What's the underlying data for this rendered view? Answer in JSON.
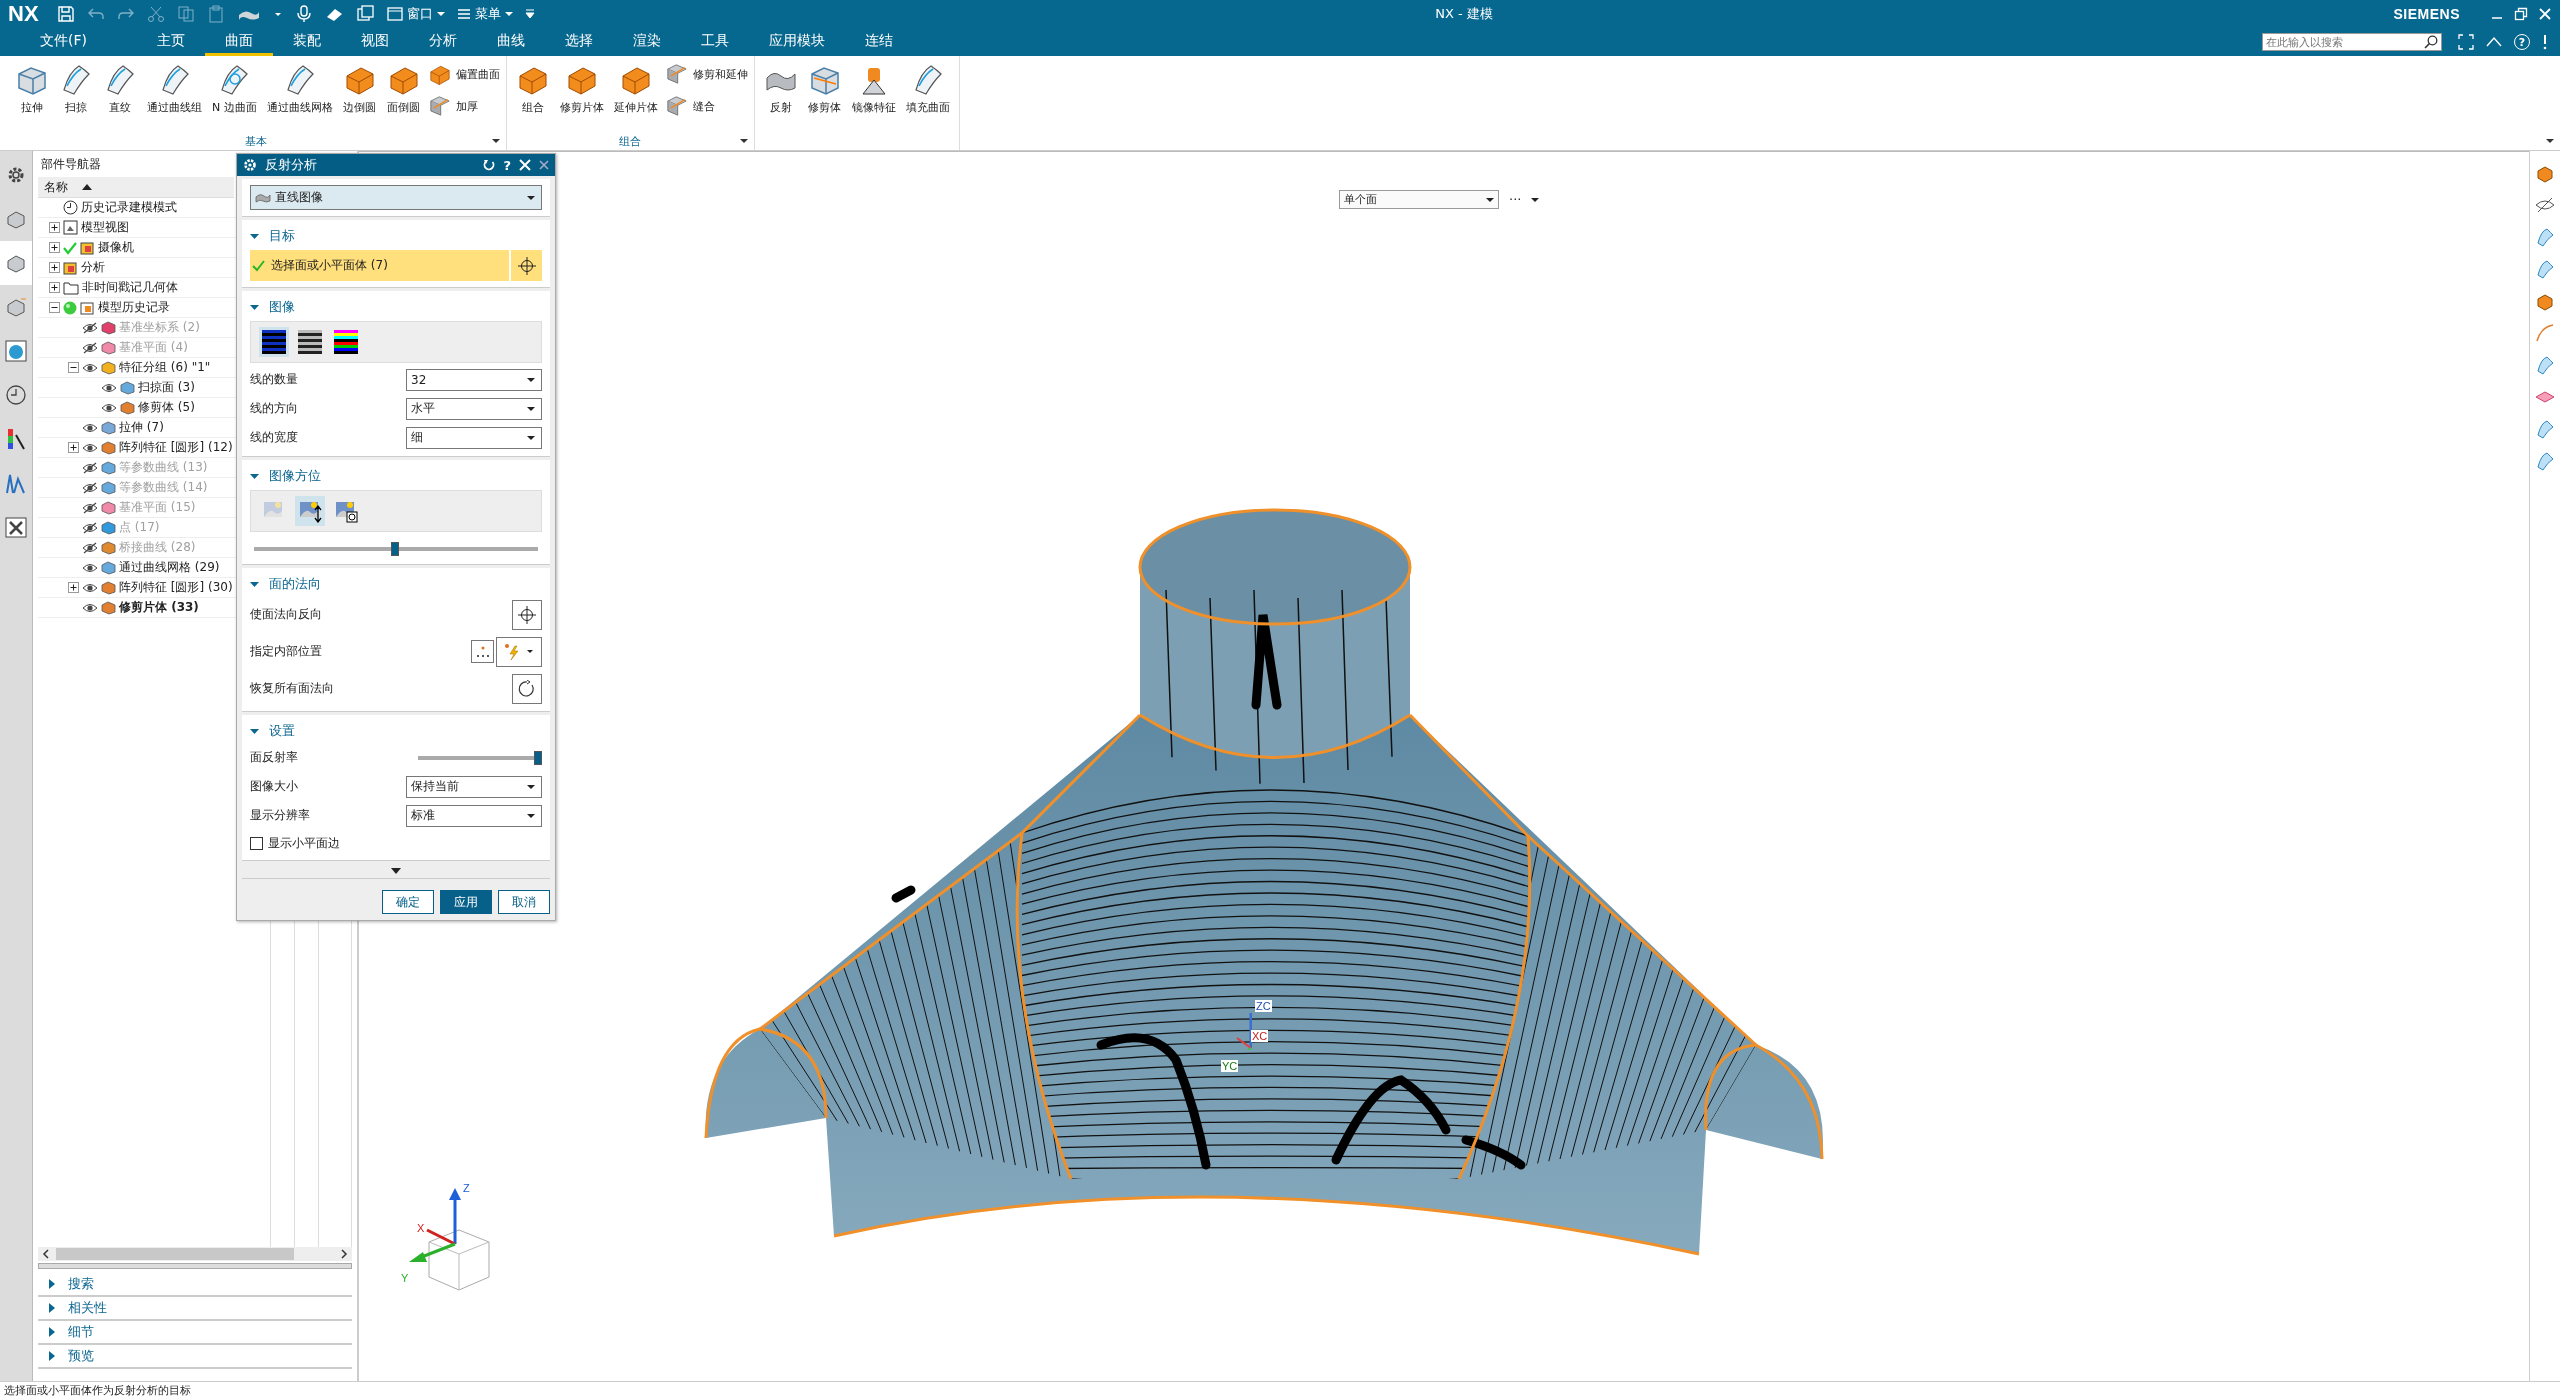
{
  "window": {
    "logo": "NX",
    "title": "NX - 建模",
    "brand": "SIEMENS"
  },
  "quick_access": {
    "window_menu": "窗口",
    "main_menu": "菜单"
  },
  "menu_tabs": [
    {
      "label": "文件(F)",
      "selected": false
    },
    {
      "label": "主页",
      "selected": false
    },
    {
      "label": "曲面",
      "selected": true
    },
    {
      "label": "装配",
      "selected": false
    },
    {
      "label": "视图",
      "selected": false
    },
    {
      "label": "分析",
      "selected": false
    },
    {
      "label": "曲线",
      "selected": false
    },
    {
      "label": "选择",
      "selected": false
    },
    {
      "label": "渲染",
      "selected": false
    },
    {
      "label": "工具",
      "selected": false
    },
    {
      "label": "应用模块",
      "selected": false
    },
    {
      "label": "连结",
      "selected": false
    }
  ],
  "search": {
    "placeholder": "在此输入以搜索"
  },
  "help_label": "?",
  "ribbon": {
    "groups": [
      {
        "label": "基本",
        "items": [
          {
            "label": "拉伸",
            "kind": "large"
          },
          {
            "label": "扫掠",
            "kind": "large"
          },
          {
            "label": "直纹",
            "kind": "large"
          },
          {
            "label": "通过曲线组",
            "kind": "large"
          },
          {
            "label": "N 边曲面",
            "kind": "large"
          },
          {
            "label": "通过曲线网格",
            "kind": "large"
          },
          {
            "label": "边倒圆",
            "kind": "large"
          },
          {
            "label": "面倒圆",
            "kind": "large"
          },
          {
            "label": "偏置曲面",
            "kind": "small"
          },
          {
            "label": "加厚",
            "kind": "small"
          }
        ]
      },
      {
        "label": "组合",
        "items": [
          {
            "label": "组合",
            "kind": "large"
          },
          {
            "label": "修剪片体",
            "kind": "large"
          },
          {
            "label": "延伸片体",
            "kind": "large"
          },
          {
            "label": "修剪和延伸",
            "kind": "small"
          },
          {
            "label": "缝合",
            "kind": "small"
          }
        ]
      },
      {
        "items": [
          {
            "label": "反射",
            "kind": "large"
          },
          {
            "label": "修剪体",
            "kind": "large"
          },
          {
            "label": "镜像特征",
            "kind": "large"
          },
          {
            "label": "填充曲面",
            "kind": "large"
          }
        ]
      }
    ]
  },
  "navigator": {
    "title": "部件导航器",
    "column": "名称",
    "tree": [
      {
        "label": "历史记录建模模式",
        "kind": "mode"
      },
      {
        "label": "模型视图",
        "kind": "views",
        "expanded": false
      },
      {
        "label": "摄像机",
        "kind": "cameras",
        "expanded": false
      },
      {
        "label": "分析",
        "kind": "analysis",
        "expanded": false
      },
      {
        "label": "非时间戳记几何体",
        "kind": "folder",
        "expanded": false
      },
      {
        "label": "模型历史记录",
        "kind": "history",
        "expanded": true,
        "children": [
          {
            "label": "基准坐标系 (2)",
            "visible": false,
            "current": false
          },
          {
            "label": "基准平面 (4)",
            "visible": false,
            "current": false
          },
          {
            "label": "特征分组 (6) \"1\"",
            "visible": true,
            "current": false,
            "expanded": true,
            "children": [
              {
                "label": "扫掠面 (3)",
                "visible": true,
                "current": false
              },
              {
                "label": "修剪体 (5)",
                "visible": true,
                "current": false
              }
            ]
          },
          {
            "label": "拉伸 (7)",
            "visible": true,
            "current": false
          },
          {
            "label": "阵列特征 [圆形] (12)",
            "visible": true,
            "current": false,
            "expanded": false
          },
          {
            "label": "等参数曲线 (13)",
            "visible": false,
            "current": false
          },
          {
            "label": "等参数曲线 (14)",
            "visible": false,
            "current": false
          },
          {
            "label": "基准平面 (15)",
            "visible": false,
            "current": false
          },
          {
            "label": "点 (17)",
            "visible": false,
            "current": false
          },
          {
            "label": "桥接曲线 (28)",
            "visible": false,
            "current": false
          },
          {
            "label": "通过曲线网格 (29)",
            "visible": true,
            "current": false
          },
          {
            "label": "阵列特征 [圆形] (30)",
            "visible": true,
            "current": false,
            "expanded": false
          },
          {
            "label": "修剪片体 (33)",
            "visible": true,
            "current": true
          }
        ]
      }
    ],
    "panels": [
      {
        "label": "搜索",
        "expanded": false
      },
      {
        "label": "相关性",
        "expanded": false
      },
      {
        "label": "细节",
        "expanded": false
      },
      {
        "label": "预览",
        "expanded": false
      }
    ]
  },
  "dialog": {
    "title": "反射分析",
    "help_label": "?",
    "type": {
      "value": "直线图像"
    },
    "sections": [
      {
        "kind": "target",
        "title": "目标",
        "expanded": true,
        "selection": {
          "label": "选择面或小平面体 (7)",
          "done": true
        }
      },
      {
        "kind": "image",
        "title": "图像",
        "expanded": true,
        "image_types": [
          {
            "selected": true
          },
          {
            "selected": false
          },
          {
            "selected": false
          }
        ],
        "fields": [
          {
            "label": "线的数量",
            "value": "32"
          },
          {
            "label": "线的方向",
            "value": "水平"
          },
          {
            "label": "线的宽度",
            "value": "细"
          }
        ]
      },
      {
        "kind": "orientation",
        "title": "图像方位",
        "expanded": true,
        "modes": [
          {
            "selected": false,
            "disabled": true
          },
          {
            "selected": true,
            "disabled": false
          },
          {
            "selected": false,
            "disabled": false
          }
        ],
        "slider": {
          "level": 0.5
        }
      },
      {
        "kind": "normals",
        "title": "面的法向",
        "expanded": true,
        "rows": [
          {
            "label": "使面法向反向",
            "kind": "pick"
          },
          {
            "label": "指定内部位置",
            "kind": "point"
          },
          {
            "label": "恢复所有面法向",
            "kind": "reset"
          }
        ]
      },
      {
        "kind": "settings",
        "title": "设置",
        "expanded": true,
        "reflectivity": {
          "label": "面反射率",
          "level": 1.0
        },
        "fields": [
          {
            "label": "图像大小",
            "value": "保持当前"
          },
          {
            "label": "显示分辨率",
            "value": "标准"
          }
        ],
        "checkbox": {
          "label": "显示小平面边",
          "checked": false
        }
      }
    ],
    "buttons": [
      {
        "label": "确定",
        "primary": false
      },
      {
        "label": "应用",
        "primary": true
      },
      {
        "label": "取消",
        "primary": false
      }
    ]
  },
  "viewport": {
    "face_filter": "单个面",
    "more": "···",
    "wcs_labels": [
      "ZC",
      "XC",
      "YC"
    ],
    "triad_labels": [
      "Z",
      "X",
      "Y"
    ]
  },
  "status_bar": {
    "message": "选择面或小平面体作为反射分析的目标"
  }
}
